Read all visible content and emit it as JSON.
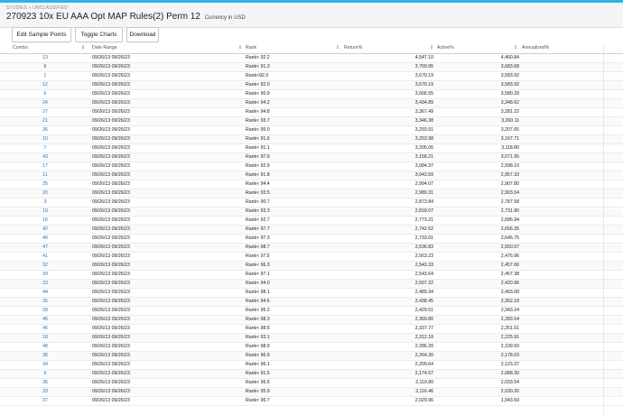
{
  "header": {
    "breadcrumb": "STUDIES » UNCLASSIFIED",
    "title": "270923 10x EU AAA Opt MAP Rules(2) Perm 12",
    "currency": "Currency in USD"
  },
  "toolbar": {
    "edit_label": "Edit Sample Points",
    "toggle_label": "Toggle Charts",
    "download_label": "Download"
  },
  "table": {
    "columns": [
      "Combo",
      "Date Range",
      "Rank",
      "Return%",
      "Active%",
      "Annualized%"
    ],
    "rows": [
      {
        "combo": "13",
        "date": "09/26/13 09/26/23",
        "rank": "Rank< 92.2",
        "ret": "4,547.10",
        "ann": "4,460.84"
      },
      {
        "combo": "8",
        "date": "09/26/13 09/26/23",
        "rank": "Rank< 91.3",
        "ret": "3,769.95",
        "ann": "3,683.68"
      },
      {
        "combo": "1",
        "date": "09/26/13 09/26/23",
        "rank": "Rank<92.0",
        "ret": "3,670.19",
        "ann": "3,583.92"
      },
      {
        "combo": "12",
        "date": "09/26/13 09/26/23",
        "rank": "Rank< 92.0",
        "ret": "3,670.19",
        "ann": "3,583.92"
      },
      {
        "combo": "6",
        "date": "09/26/13 09/26/23",
        "rank": "Rank< 90.9",
        "ret": "3,666.55",
        "ann": "3,580.29"
      },
      {
        "combo": "24",
        "date": "09/26/13 09/26/23",
        "rank": "Rank< 94.2",
        "ret": "3,434.89",
        "ann": "3,348.62"
      },
      {
        "combo": "27",
        "date": "09/26/13 09/26/23",
        "rank": "Rank< 94.8",
        "ret": "3,367.49",
        "ann": "3,281.22"
      },
      {
        "combo": "21",
        "date": "09/26/13 09/26/23",
        "rank": "Rank< 93.7",
        "ret": "3,346.38",
        "ann": "3,260.11"
      },
      {
        "combo": "35",
        "date": "09/26/13 09/26/23",
        "rank": "Rank< 95.0",
        "ret": "3,293.91",
        "ann": "3,207.65"
      },
      {
        "combo": "10",
        "date": "09/26/13 09/26/23",
        "rank": "Rank< 91.6",
        "ret": "3,253.98",
        "ann": "3,167.71"
      },
      {
        "combo": "7",
        "date": "09/26/13 09/26/23",
        "rank": "Rank< 91.1",
        "ret": "3,205.06",
        "ann": "3,118.80"
      },
      {
        "combo": "43",
        "date": "09/26/13 09/26/23",
        "rank": "Rank< 97.9",
        "ret": "3,158.21",
        "ann": "3,071.95"
      },
      {
        "combo": "17",
        "date": "09/26/13 09/26/23",
        "rank": "Rank< 92.9",
        "ret": "3,084.37",
        "ann": "2,998.10"
      },
      {
        "combo": "11",
        "date": "09/26/13 09/26/23",
        "rank": "Rank< 91.8",
        "ret": "3,043.59",
        "ann": "2,957.33"
      },
      {
        "combo": "25",
        "date": "09/26/13 09/26/23",
        "rank": "Rank< 94.4",
        "ret": "2,994.07",
        "ann": "2,907.80"
      },
      {
        "combo": "20",
        "date": "09/26/13 09/26/23",
        "rank": "Rank< 93.5",
        "ret": "2,989.31",
        "ann": "2,903.04"
      },
      {
        "combo": "3",
        "date": "09/26/13 09/26/23",
        "rank": "Rank< 90.7",
        "ret": "2,873.84",
        "ann": "2,787.58"
      },
      {
        "combo": "19",
        "date": "09/26/13 09/26/23",
        "rank": "Rank< 93.3",
        "ret": "2,818.07",
        "ann": "2,731.80"
      },
      {
        "combo": "16",
        "date": "09/26/13 09/26/23",
        "rank": "Rank< 92.7",
        "ret": "2,773.21",
        "ann": "2,686.94"
      },
      {
        "combo": "42",
        "date": "09/26/13 09/26/23",
        "rank": "Rank< 97.7",
        "ret": "2,742.62",
        "ann": "2,656.35"
      },
      {
        "combo": "40",
        "date": "09/26/13 09/26/23",
        "rank": "Rank< 97.3",
        "ret": "2,733.01",
        "ann": "2,646.75"
      },
      {
        "combo": "47",
        "date": "09/26/13 09/26/23",
        "rank": "Rank< 98.7",
        "ret": "2,636.83",
        "ann": "2,550.57"
      },
      {
        "combo": "41",
        "date": "09/26/13 09/26/23",
        "rank": "Rank< 97.5",
        "ret": "2,563.23",
        "ann": "2,476.96"
      },
      {
        "combo": "32",
        "date": "09/26/13 09/26/23",
        "rank": "Rank< 96.3",
        "ret": "2,543.33",
        "ann": "2,457.06"
      },
      {
        "combo": "39",
        "date": "09/26/13 09/26/23",
        "rank": "Rank< 97.1",
        "ret": "2,543.64",
        "ann": "2,457.38"
      },
      {
        "combo": "23",
        "date": "09/26/13 09/26/23",
        "rank": "Rank< 94.0",
        "ret": "2,507.22",
        "ann": "2,420.96"
      },
      {
        "combo": "44",
        "date": "09/26/13 09/26/23",
        "rank": "Rank< 98.1",
        "ret": "2,489.34",
        "ann": "2,403.08"
      },
      {
        "combo": "26",
        "date": "09/26/13 09/26/23",
        "rank": "Rank< 94.6",
        "ret": "2,438.45",
        "ann": "2,352.18"
      },
      {
        "combo": "29",
        "date": "09/26/13 09/26/23",
        "rank": "Rank< 95.2",
        "ret": "2,429.51",
        "ann": "2,343.24"
      },
      {
        "combo": "45",
        "date": "09/26/13 09/26/23",
        "rank": "Rank< 98.3",
        "ret": "2,369.80",
        "ann": "2,283.54"
      },
      {
        "combo": "46",
        "date": "09/26/13 09/26/23",
        "rank": "Rank< 98.5",
        "ret": "2,337.77",
        "ann": "2,251.51"
      },
      {
        "combo": "18",
        "date": "09/26/13 09/26/23",
        "rank": "Rank< 93.1",
        "ret": "2,312.18",
        "ann": "2,225.91"
      },
      {
        "combo": "48",
        "date": "09/26/13 09/26/23",
        "rank": "Rank< 98.9",
        "ret": "2,286.20",
        "ann": "2,199.93"
      },
      {
        "combo": "38",
        "date": "09/26/13 09/26/23",
        "rank": "Rank< 96.9",
        "ret": "2,264.30",
        "ann": "2,178.03"
      },
      {
        "combo": "34",
        "date": "09/26/13 09/26/23",
        "rank": "Rank< 96.1",
        "ret": "2,209.64",
        "ann": "2,123.37"
      },
      {
        "combo": "9",
        "date": "09/26/13 09/26/23",
        "rank": "Rank< 91.5",
        "ret": "2,174.57",
        "ann": "2,088.30"
      },
      {
        "combo": "36",
        "date": "09/26/13 09/26/23",
        "rank": "Rank< 96.5",
        "ret": "2,119.80",
        "ann": "2,033.54"
      },
      {
        "combo": "33",
        "date": "09/26/13 09/26/23",
        "rank": "Rank< 95.9",
        "ret": "2,116.46",
        "ann": "2,030.20"
      },
      {
        "combo": "37",
        "date": "09/26/13 09/26/23",
        "rank": "Rank< 96.7",
        "ret": "2,029.96",
        "ann": "1,943.69"
      }
    ]
  }
}
